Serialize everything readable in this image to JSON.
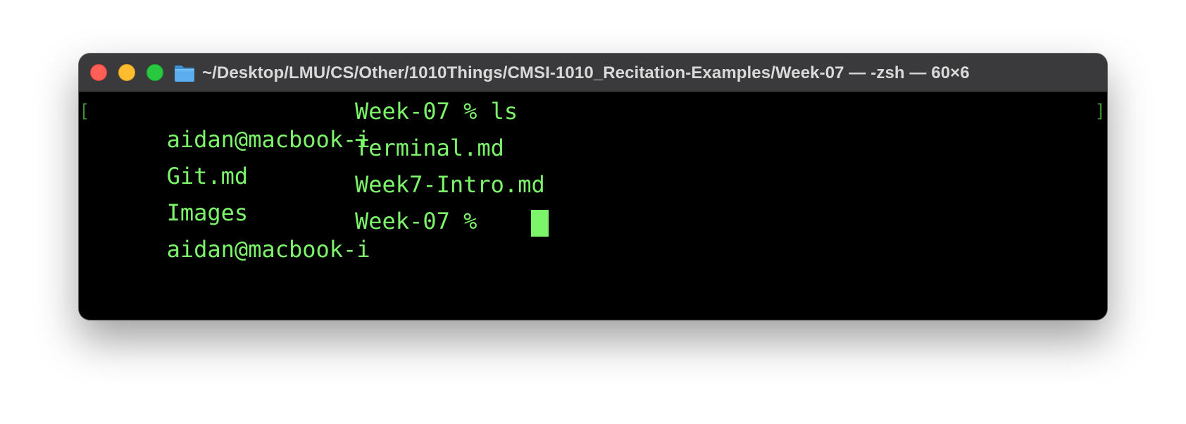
{
  "window": {
    "title": "~/Desktop/LMU/CS/Other/1010Things/CMSI-1010_Recitation-Examples/Week-07 — -zsh — 60×6",
    "title_icon": "folder-icon",
    "traffic_lights": {
      "close": "#ff5f57",
      "minimize": "#febc2e",
      "zoom": "#28c840"
    }
  },
  "terminal": {
    "text_color": "#7cf56a",
    "background": "#000000",
    "bracket_left": "[",
    "bracket_right": "]",
    "lines": [
      {
        "col1": "aidan@macbook-i",
        "col2": "Week-07 % ls"
      },
      {
        "col1": "Git.md",
        "col2": "Terminal.md"
      },
      {
        "col1": "Images",
        "col2": "Week7-Intro.md"
      },
      {
        "col1": "aidan@macbook-i",
        "col2": "Week-07 %"
      }
    ]
  }
}
